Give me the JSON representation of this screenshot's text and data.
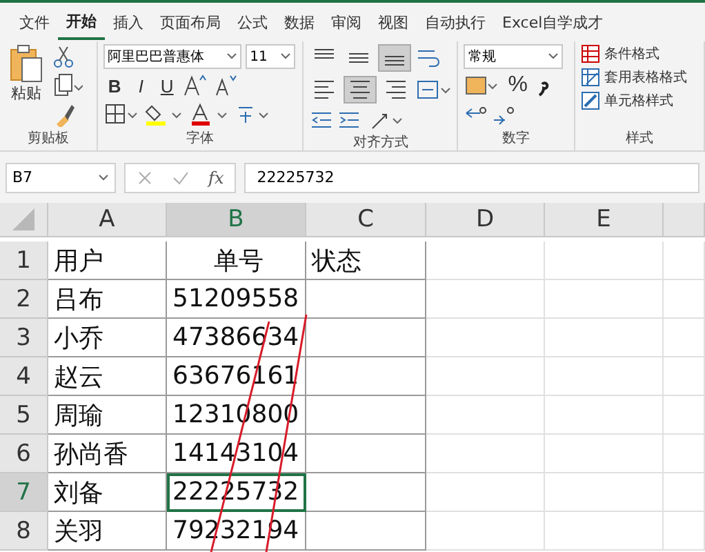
{
  "tabs": [
    {
      "label": "文件",
      "selected": false
    },
    {
      "label": "开始",
      "selected": true
    },
    {
      "label": "插入",
      "selected": false
    },
    {
      "label": "页面布局",
      "selected": false
    },
    {
      "label": "公式",
      "selected": false
    },
    {
      "label": "数据",
      "selected": false
    },
    {
      "label": "审阅",
      "selected": false
    },
    {
      "label": "视图",
      "selected": false
    },
    {
      "label": "自动执行",
      "selected": false
    },
    {
      "label": "Excel自学成才",
      "selected": false
    }
  ],
  "ribbon": {
    "clipboard": {
      "paste": "粘贴",
      "label": "剪贴板"
    },
    "font": {
      "font_name": "阿里巴巴普惠体",
      "font_size": "11",
      "styles": [
        "B",
        "I",
        "U"
      ],
      "label": "字体"
    },
    "alignment": {
      "buttons": [
        {
          "kind": "top",
          "selected": false
        },
        {
          "kind": "middle",
          "selected": false
        },
        {
          "kind": "bottom",
          "selected": true
        },
        {
          "kind": "left",
          "selected": false
        },
        {
          "kind": "center",
          "selected": true
        },
        {
          "kind": "right",
          "selected": false
        }
      ],
      "label": "对齐方式"
    },
    "number": {
      "format": "常规",
      "percent": "%",
      "label": "数字"
    },
    "styles": {
      "items": [
        "条件格式",
        "套用表格格式",
        "单元格样式"
      ],
      "label": "样式"
    }
  },
  "formula_bar": {
    "name_box": "B7",
    "fx": "fx",
    "formula": "22225732"
  },
  "sheet": {
    "columns": [
      {
        "label": "A",
        "selected": false
      },
      {
        "label": "B",
        "selected": true
      },
      {
        "label": "C",
        "selected": false
      },
      {
        "label": "D",
        "selected": false
      },
      {
        "label": "E",
        "selected": false
      }
    ],
    "rows": [
      {
        "number": "1",
        "selected": false,
        "cells": [
          {
            "text": "用户",
            "active": false
          },
          {
            "text": "单号",
            "active": false
          },
          {
            "text": "状态",
            "active": false
          }
        ]
      },
      {
        "number": "2",
        "selected": false,
        "cells": [
          {
            "text": "吕布",
            "active": false
          },
          {
            "text": "51209558",
            "active": false
          }
        ]
      },
      {
        "number": "3",
        "selected": false,
        "cells": [
          {
            "text": "小乔",
            "active": false
          },
          {
            "text": "47386634",
            "active": false
          }
        ]
      },
      {
        "number": "4",
        "selected": false,
        "cells": [
          {
            "text": "赵云",
            "active": false
          },
          {
            "text": "63676161",
            "active": false
          }
        ]
      },
      {
        "number": "5",
        "selected": false,
        "cells": [
          {
            "text": "周瑜",
            "active": false
          },
          {
            "text": "12310800",
            "active": false
          }
        ]
      },
      {
        "number": "6",
        "selected": false,
        "cells": [
          {
            "text": "孙尚香",
            "active": false
          },
          {
            "text": "14143104",
            "active": false
          }
        ]
      },
      {
        "number": "7",
        "selected": true,
        "cells": [
          {
            "text": "刘备",
            "active": false
          },
          {
            "text": "22225732",
            "active": true
          }
        ]
      },
      {
        "number": "8",
        "selected": false,
        "cells": [
          {
            "text": "关羽",
            "active": false
          },
          {
            "text": "79232194",
            "active": false
          }
        ]
      }
    ]
  }
}
